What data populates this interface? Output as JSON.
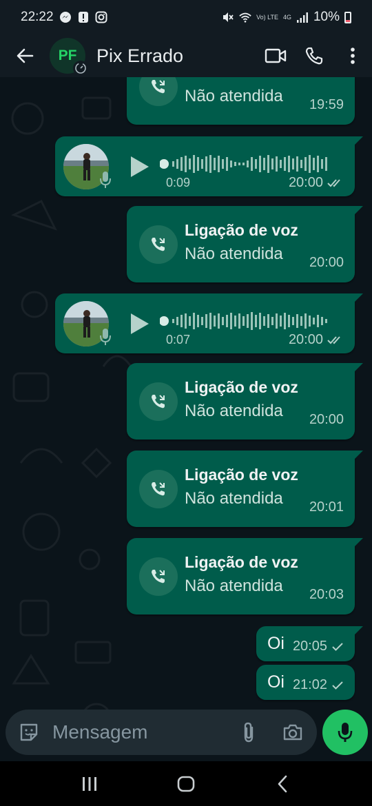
{
  "status_bar": {
    "time": "22:22",
    "network_label": "4G",
    "volte_label": "Vo) LTE",
    "battery": "10%",
    "icons": [
      "messenger-icon",
      "alert-icon",
      "instagram-icon",
      "mute-icon",
      "wifi-icon",
      "signal-icon",
      "battery-icon"
    ]
  },
  "header": {
    "avatar_initials": "PF",
    "contact_name": "Pix Errado",
    "icons": [
      "back-arrow-icon",
      "video-call-icon",
      "phone-icon",
      "more-vert-icon"
    ]
  },
  "messages": [
    {
      "type": "call",
      "title": "",
      "subtitle": "Não atendida",
      "time": "19:59"
    },
    {
      "type": "voice",
      "duration": "0:09",
      "time": "20:00"
    },
    {
      "type": "call",
      "title": "Ligação de voz",
      "subtitle": "Não atendida",
      "time": "20:00"
    },
    {
      "type": "voice",
      "duration": "0:07",
      "time": "20:00"
    },
    {
      "type": "call",
      "title": "Ligação de voz",
      "subtitle": "Não atendida",
      "time": "20:00"
    },
    {
      "type": "call",
      "title": "Ligação de voz",
      "subtitle": "Não atendida",
      "time": "20:01"
    },
    {
      "type": "call",
      "title": "Ligação de voz",
      "subtitle": "Não atendida",
      "time": "20:03"
    },
    {
      "type": "text",
      "text": "Oi",
      "time": "20:05"
    },
    {
      "type": "text",
      "text": "Oi",
      "time": "21:02"
    }
  ],
  "composer": {
    "placeholder": "Mensagem",
    "icons": [
      "sticker-icon",
      "attach-icon",
      "camera-icon",
      "mic-icon"
    ]
  },
  "nav_bar": {
    "icons": [
      "recents-icon",
      "home-icon",
      "back-icon"
    ]
  },
  "colors": {
    "bubble_outgoing": "#005c4b",
    "chat_background": "#0b141a",
    "accent_green": "#21c063",
    "header_background": "#121b22"
  }
}
